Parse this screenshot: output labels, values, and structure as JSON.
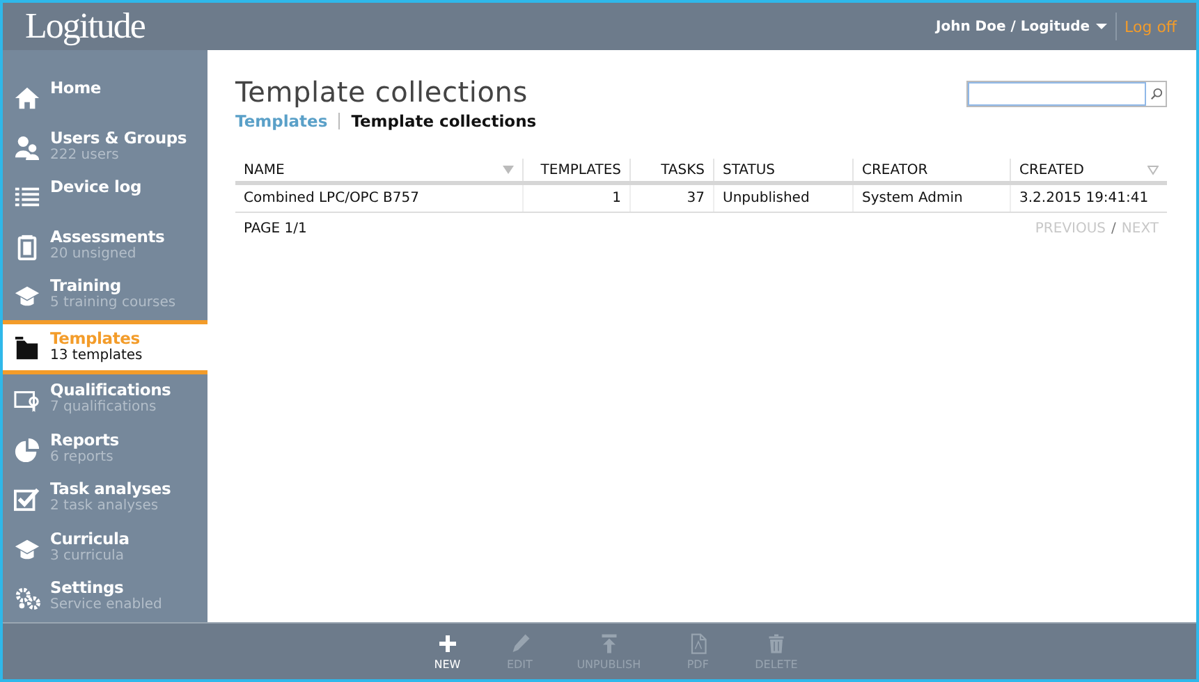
{
  "header": {
    "logo": "Logitude",
    "user": "John Doe / Logitude",
    "logoff": "Log off"
  },
  "sidebar": {
    "items": [
      {
        "label": "Home",
        "selected": false
      },
      {
        "label": "Users & Groups",
        "sub": "222 users",
        "selected": false
      },
      {
        "label": "Device log",
        "selected": false
      },
      {
        "label": "Assessments",
        "sub": "20 unsigned",
        "selected": false
      },
      {
        "label": "Training",
        "sub": "5 training courses",
        "selected": false
      },
      {
        "label": "Templates",
        "sub": "13 templates",
        "selected": true
      },
      {
        "label": "Qualifications",
        "sub": "7 qualifications",
        "selected": false
      },
      {
        "label": "Reports",
        "sub": "6 reports",
        "selected": false
      },
      {
        "label": "Task analyses",
        "sub": "2 task analyses",
        "selected": false
      },
      {
        "label": "Curricula",
        "sub": "3 curricula",
        "selected": false
      },
      {
        "label": "Settings",
        "sub": "Service enabled",
        "selected": false
      }
    ]
  },
  "page": {
    "title": "Template collections",
    "breadcrumb": [
      {
        "label": "Templates",
        "selected": false
      },
      {
        "label": "Template collections",
        "selected": true
      }
    ]
  },
  "table": {
    "columns": [
      {
        "label": "NAME",
        "sorted": true
      },
      {
        "label": "TEMPLATES"
      },
      {
        "label": "TASKS"
      },
      {
        "label": "STATUS"
      },
      {
        "label": "CREATOR"
      },
      {
        "label": "CREATED",
        "sorted": false
      }
    ],
    "rows": [
      [
        "Combined LPC/OPC B757",
        "1",
        "37",
        "Unpublished",
        "System Admin",
        "3.2.2015 19:41:41"
      ]
    ]
  },
  "pager": {
    "page": "PAGE 1/1",
    "previous": {
      "label": "PREVIOUS",
      "disabled": true
    },
    "separator": "/",
    "next": {
      "label": "NEXT",
      "disabled": true
    }
  },
  "toolbar": [
    {
      "label": "NEW",
      "disabled": false
    },
    {
      "label": "EDIT",
      "disabled": true
    },
    {
      "label": "UNPUBLISH",
      "disabled": true
    },
    {
      "label": "PDF",
      "disabled": true
    },
    {
      "label": "DELETE",
      "disabled": true
    }
  ]
}
